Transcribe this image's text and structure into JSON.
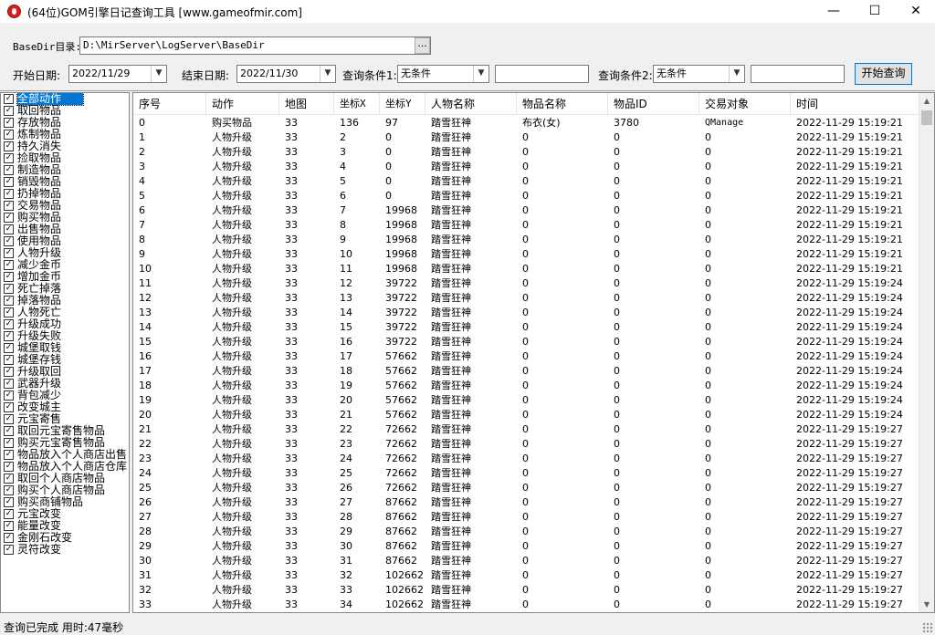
{
  "window": {
    "title": "(64位)GOM引擎日记查询工具 [www.gameofmir.com]",
    "minimize": "—",
    "maximize": "☐",
    "close": "✕"
  },
  "toolbar": {
    "basedir_label": "BaseDir目录:",
    "basedir_value": "D:\\MirServer\\LogServer\\BaseDir",
    "browse_label": "...",
    "start_label": "开始日期:",
    "start_value": "2022/11/29",
    "end_label": "结束日期:",
    "end_value": "2022/11/30",
    "cond1_label": "查询条件1:",
    "cond1_value": "无条件",
    "cond1_text": "",
    "cond2_label": "查询条件2:",
    "cond2_value": "无条件",
    "cond2_text": "",
    "query_button": "开始查询"
  },
  "actions": [
    "全部动作",
    "取回物品",
    "存放物品",
    "炼制物品",
    "持久消失",
    "捡取物品",
    "制造物品",
    "销毁物品",
    "扔掉物品",
    "交易物品",
    "购买物品",
    "出售物品",
    "使用物品",
    "人物升级",
    "减少金币",
    "增加金币",
    "死亡掉落",
    "掉落物品",
    "人物死亡",
    "升级成功",
    "升级失败",
    "城堡取钱",
    "城堡存钱",
    "升级取回",
    "武器升级",
    "背包减少",
    "改变城主",
    "元宝寄售",
    "取回元宝寄售物品",
    "购买元宝寄售物品",
    "物品放入个人商店出售",
    "物品放入个人商店仓库",
    "取回个人商店物品",
    "购买个人商店物品",
    "购买商铺物品",
    "元宝改变",
    "能量改变",
    "金刚石改变",
    "灵符改变"
  ],
  "table": {
    "columns": [
      "序号",
      "动作",
      "地图",
      "坐标X",
      "坐标Y",
      "人物名称",
      "物品名称",
      "物品ID",
      "交易对象",
      "时间"
    ],
    "rows": [
      [
        "0",
        "购买物品",
        "33",
        "136",
        "97",
        "踏雪狂神",
        "布衣(女)",
        "3780",
        "QManage",
        "2022-11-29 15:19:21"
      ],
      [
        "1",
        "人物升级",
        "33",
        "2",
        "0",
        "踏雪狂神",
        "0",
        "0",
        "0",
        "2022-11-29 15:19:21"
      ],
      [
        "2",
        "人物升级",
        "33",
        "3",
        "0",
        "踏雪狂神",
        "0",
        "0",
        "0",
        "2022-11-29 15:19:21"
      ],
      [
        "3",
        "人物升级",
        "33",
        "4",
        "0",
        "踏雪狂神",
        "0",
        "0",
        "0",
        "2022-11-29 15:19:21"
      ],
      [
        "4",
        "人物升级",
        "33",
        "5",
        "0",
        "踏雪狂神",
        "0",
        "0",
        "0",
        "2022-11-29 15:19:21"
      ],
      [
        "5",
        "人物升级",
        "33",
        "6",
        "0",
        "踏雪狂神",
        "0",
        "0",
        "0",
        "2022-11-29 15:19:21"
      ],
      [
        "6",
        "人物升级",
        "33",
        "7",
        "19968",
        "踏雪狂神",
        "0",
        "0",
        "0",
        "2022-11-29 15:19:21"
      ],
      [
        "7",
        "人物升级",
        "33",
        "8",
        "19968",
        "踏雪狂神",
        "0",
        "0",
        "0",
        "2022-11-29 15:19:21"
      ],
      [
        "8",
        "人物升级",
        "33",
        "9",
        "19968",
        "踏雪狂神",
        "0",
        "0",
        "0",
        "2022-11-29 15:19:21"
      ],
      [
        "9",
        "人物升级",
        "33",
        "10",
        "19968",
        "踏雪狂神",
        "0",
        "0",
        "0",
        "2022-11-29 15:19:21"
      ],
      [
        "10",
        "人物升级",
        "33",
        "11",
        "19968",
        "踏雪狂神",
        "0",
        "0",
        "0",
        "2022-11-29 15:19:21"
      ],
      [
        "11",
        "人物升级",
        "33",
        "12",
        "39722",
        "踏雪狂神",
        "0",
        "0",
        "0",
        "2022-11-29 15:19:24"
      ],
      [
        "12",
        "人物升级",
        "33",
        "13",
        "39722",
        "踏雪狂神",
        "0",
        "0",
        "0",
        "2022-11-29 15:19:24"
      ],
      [
        "13",
        "人物升级",
        "33",
        "14",
        "39722",
        "踏雪狂神",
        "0",
        "0",
        "0",
        "2022-11-29 15:19:24"
      ],
      [
        "14",
        "人物升级",
        "33",
        "15",
        "39722",
        "踏雪狂神",
        "0",
        "0",
        "0",
        "2022-11-29 15:19:24"
      ],
      [
        "15",
        "人物升级",
        "33",
        "16",
        "39722",
        "踏雪狂神",
        "0",
        "0",
        "0",
        "2022-11-29 15:19:24"
      ],
      [
        "16",
        "人物升级",
        "33",
        "17",
        "57662",
        "踏雪狂神",
        "0",
        "0",
        "0",
        "2022-11-29 15:19:24"
      ],
      [
        "17",
        "人物升级",
        "33",
        "18",
        "57662",
        "踏雪狂神",
        "0",
        "0",
        "0",
        "2022-11-29 15:19:24"
      ],
      [
        "18",
        "人物升级",
        "33",
        "19",
        "57662",
        "踏雪狂神",
        "0",
        "0",
        "0",
        "2022-11-29 15:19:24"
      ],
      [
        "19",
        "人物升级",
        "33",
        "20",
        "57662",
        "踏雪狂神",
        "0",
        "0",
        "0",
        "2022-11-29 15:19:24"
      ],
      [
        "20",
        "人物升级",
        "33",
        "21",
        "57662",
        "踏雪狂神",
        "0",
        "0",
        "0",
        "2022-11-29 15:19:24"
      ],
      [
        "21",
        "人物升级",
        "33",
        "22",
        "72662",
        "踏雪狂神",
        "0",
        "0",
        "0",
        "2022-11-29 15:19:27"
      ],
      [
        "22",
        "人物升级",
        "33",
        "23",
        "72662",
        "踏雪狂神",
        "0",
        "0",
        "0",
        "2022-11-29 15:19:27"
      ],
      [
        "23",
        "人物升级",
        "33",
        "24",
        "72662",
        "踏雪狂神",
        "0",
        "0",
        "0",
        "2022-11-29 15:19:27"
      ],
      [
        "24",
        "人物升级",
        "33",
        "25",
        "72662",
        "踏雪狂神",
        "0",
        "0",
        "0",
        "2022-11-29 15:19:27"
      ],
      [
        "25",
        "人物升级",
        "33",
        "26",
        "72662",
        "踏雪狂神",
        "0",
        "0",
        "0",
        "2022-11-29 15:19:27"
      ],
      [
        "26",
        "人物升级",
        "33",
        "27",
        "87662",
        "踏雪狂神",
        "0",
        "0",
        "0",
        "2022-11-29 15:19:27"
      ],
      [
        "27",
        "人物升级",
        "33",
        "28",
        "87662",
        "踏雪狂神",
        "0",
        "0",
        "0",
        "2022-11-29 15:19:27"
      ],
      [
        "28",
        "人物升级",
        "33",
        "29",
        "87662",
        "踏雪狂神",
        "0",
        "0",
        "0",
        "2022-11-29 15:19:27"
      ],
      [
        "29",
        "人物升级",
        "33",
        "30",
        "87662",
        "踏雪狂神",
        "0",
        "0",
        "0",
        "2022-11-29 15:19:27"
      ],
      [
        "30",
        "人物升级",
        "33",
        "31",
        "87662",
        "踏雪狂神",
        "0",
        "0",
        "0",
        "2022-11-29 15:19:27"
      ],
      [
        "31",
        "人物升级",
        "33",
        "32",
        "102662",
        "踏雪狂神",
        "0",
        "0",
        "0",
        "2022-11-29 15:19:27"
      ],
      [
        "32",
        "人物升级",
        "33",
        "33",
        "102662",
        "踏雪狂神",
        "0",
        "0",
        "0",
        "2022-11-29 15:19:27"
      ],
      [
        "33",
        "人物升级",
        "33",
        "34",
        "102662",
        "踏雪狂神",
        "0",
        "0",
        "0",
        "2022-11-29 15:19:27"
      ]
    ]
  },
  "status": {
    "text": "查询已完成 用时:47毫秒"
  },
  "icons": {
    "app": "app-logo-icon",
    "checkbox": "checkmark-icon",
    "dropdown": "chevron-down-icon"
  }
}
